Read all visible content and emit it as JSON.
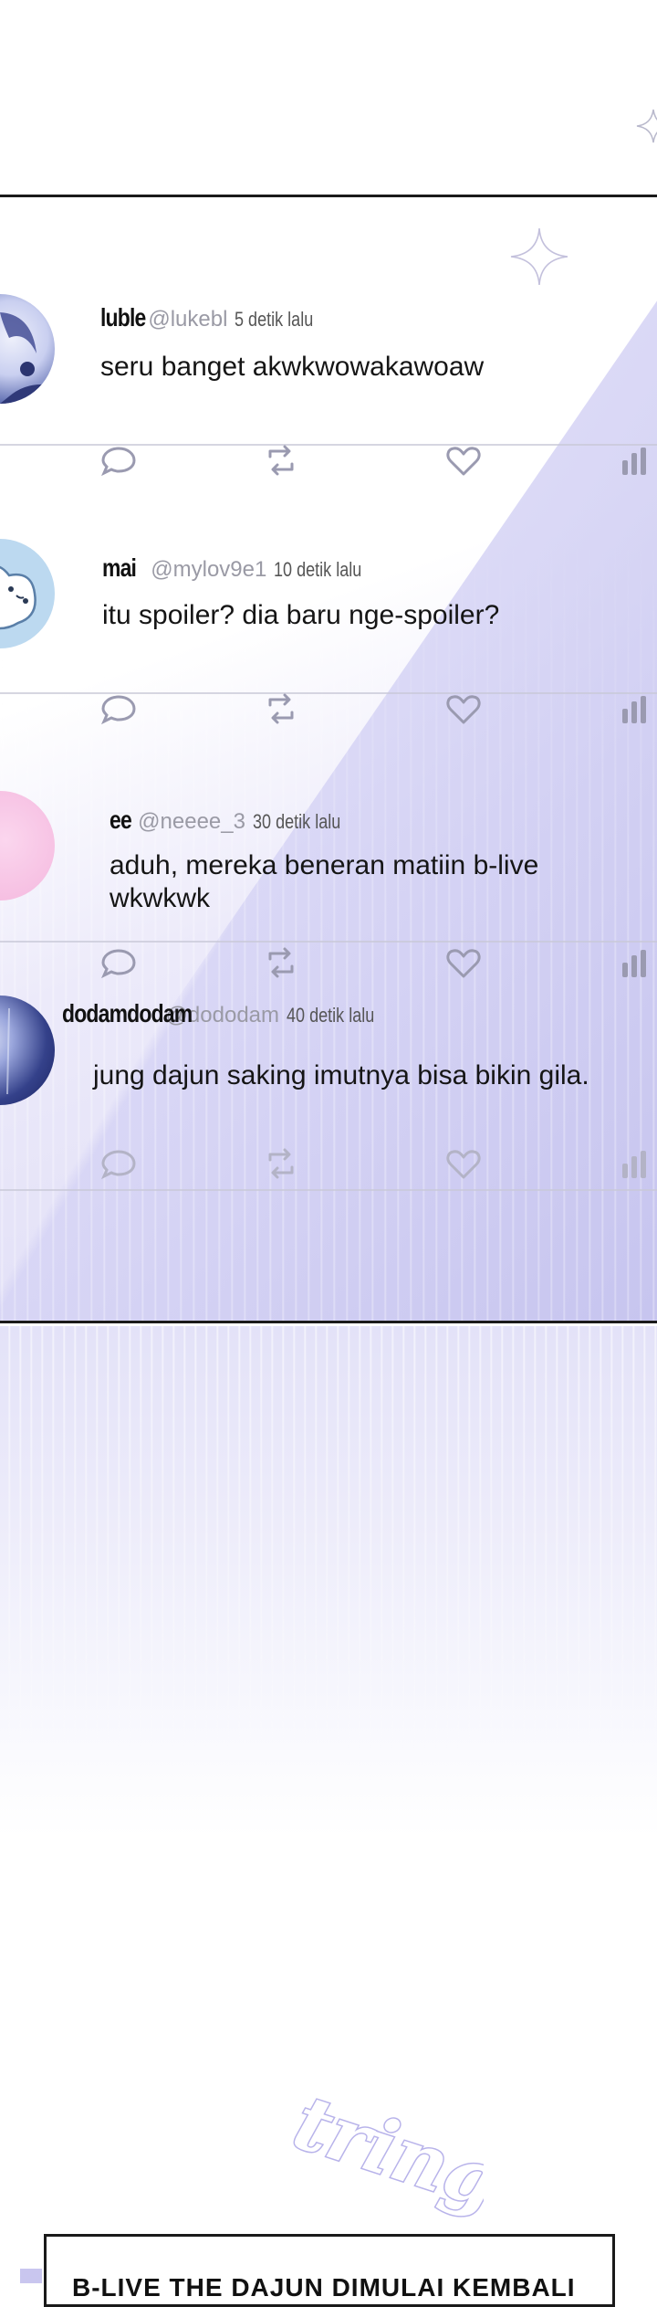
{
  "tweets": [
    {
      "username": "luble",
      "handle": "@lukebl",
      "time": "5 detik lalu",
      "text": "seru banget akwkwowakawoaw",
      "avatar_icon": "boy-with-headset-avatar-icon",
      "avatar_colors": [
        "#dfe3f7",
        "#3f4a8f"
      ]
    },
    {
      "username": "mai",
      "handle": "@mylov9e1",
      "time": "10 detik lalu",
      "text": "itu spoiler? dia baru nge-spoiler?",
      "avatar_icon": "white-bear-avatar-icon",
      "avatar_colors": [
        "#bcd9f0",
        "#ffffff"
      ]
    },
    {
      "username": "ee",
      "handle": "@neeee_3",
      "time": "30 detik lalu",
      "text": "aduh, mereka beneran matiin b-live wkwkwk",
      "avatar_icon": "pink-avatar-icon",
      "avatar_colors": [
        "#f7c6e6",
        "#f2b4dc"
      ]
    },
    {
      "username": "dodamdodam",
      "handle": "@dododam",
      "time": "40 detik lalu",
      "text": "jung dajun saking imutnya bisa bikin gila.",
      "avatar_icon": "night-sky-avatar-icon",
      "avatar_colors": [
        "#1e2a6b",
        "#c8d0ef"
      ]
    }
  ],
  "action_icons": [
    "reply-icon",
    "retweet-icon",
    "like-icon",
    "stats-icon"
  ],
  "sfx": "tring!",
  "caption": "B-LIVE THE DAJUN DIMULAI KEMBALI",
  "colors": {
    "icon_gray": "#9a9ab0",
    "accent_lavender": "#c9c6ef",
    "border": "#1a1a1a"
  }
}
